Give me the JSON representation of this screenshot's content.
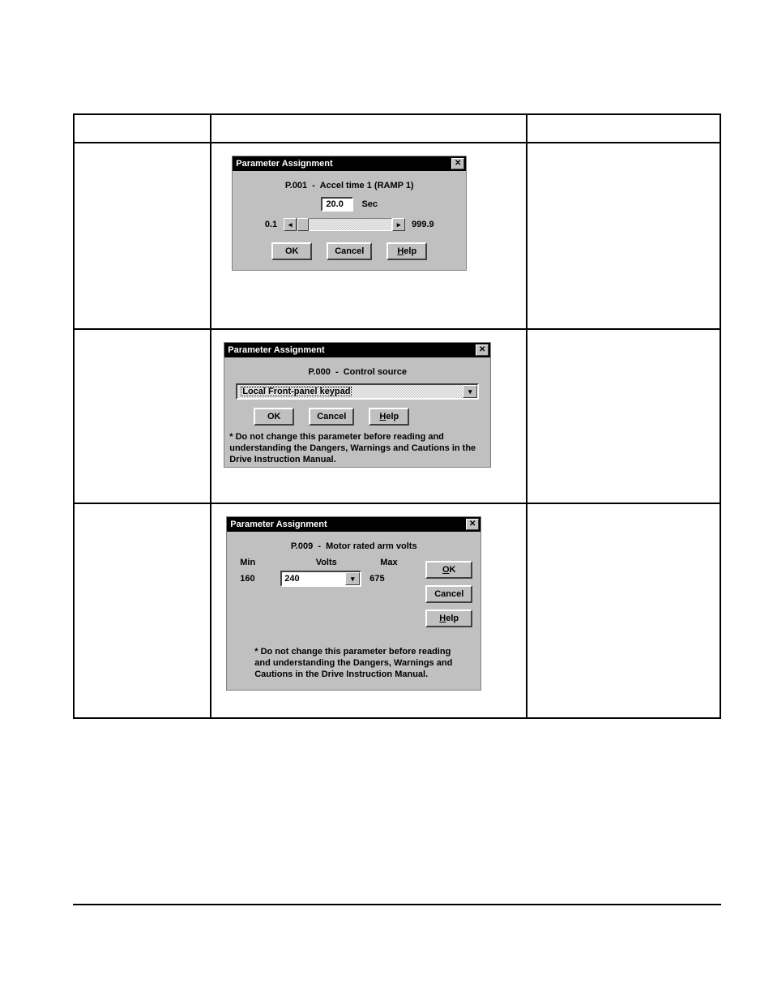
{
  "dialog1": {
    "title": "Parameter Assignment",
    "heading": "P.001  -  Accel time 1 (RAMP 1)",
    "value": "20.0",
    "unit": "Sec",
    "min": "0.1",
    "max": "999.9",
    "ok": "OK",
    "cancel": "Cancel",
    "help_prefix": "H",
    "help_rest": "elp"
  },
  "dialog2": {
    "title": "Parameter Assignment",
    "heading": "P.000  -  Control source",
    "selected": "Local Front-panel keypad",
    "ok": "OK",
    "cancel": "Cancel",
    "help_prefix": "H",
    "help_rest": "elp",
    "warning": "* Do not change this parameter before reading and understanding the Dangers, Warnings and Cautions in the Drive Instruction Manual."
  },
  "dialog3": {
    "title": "Parameter Assignment",
    "heading": "P.009  -  Motor rated arm volts",
    "unit": "Volts",
    "min_label": "Min",
    "max_label": "Max",
    "min": "160",
    "max": "675",
    "value": "240",
    "ok_prefix": "O",
    "ok_rest": "K",
    "cancel": "Cancel",
    "help_prefix": "H",
    "help_rest": "elp",
    "warning": "* Do not change this parameter before reading and understanding the Dangers, Warnings and Cautions in the Drive Instruction Manual."
  }
}
